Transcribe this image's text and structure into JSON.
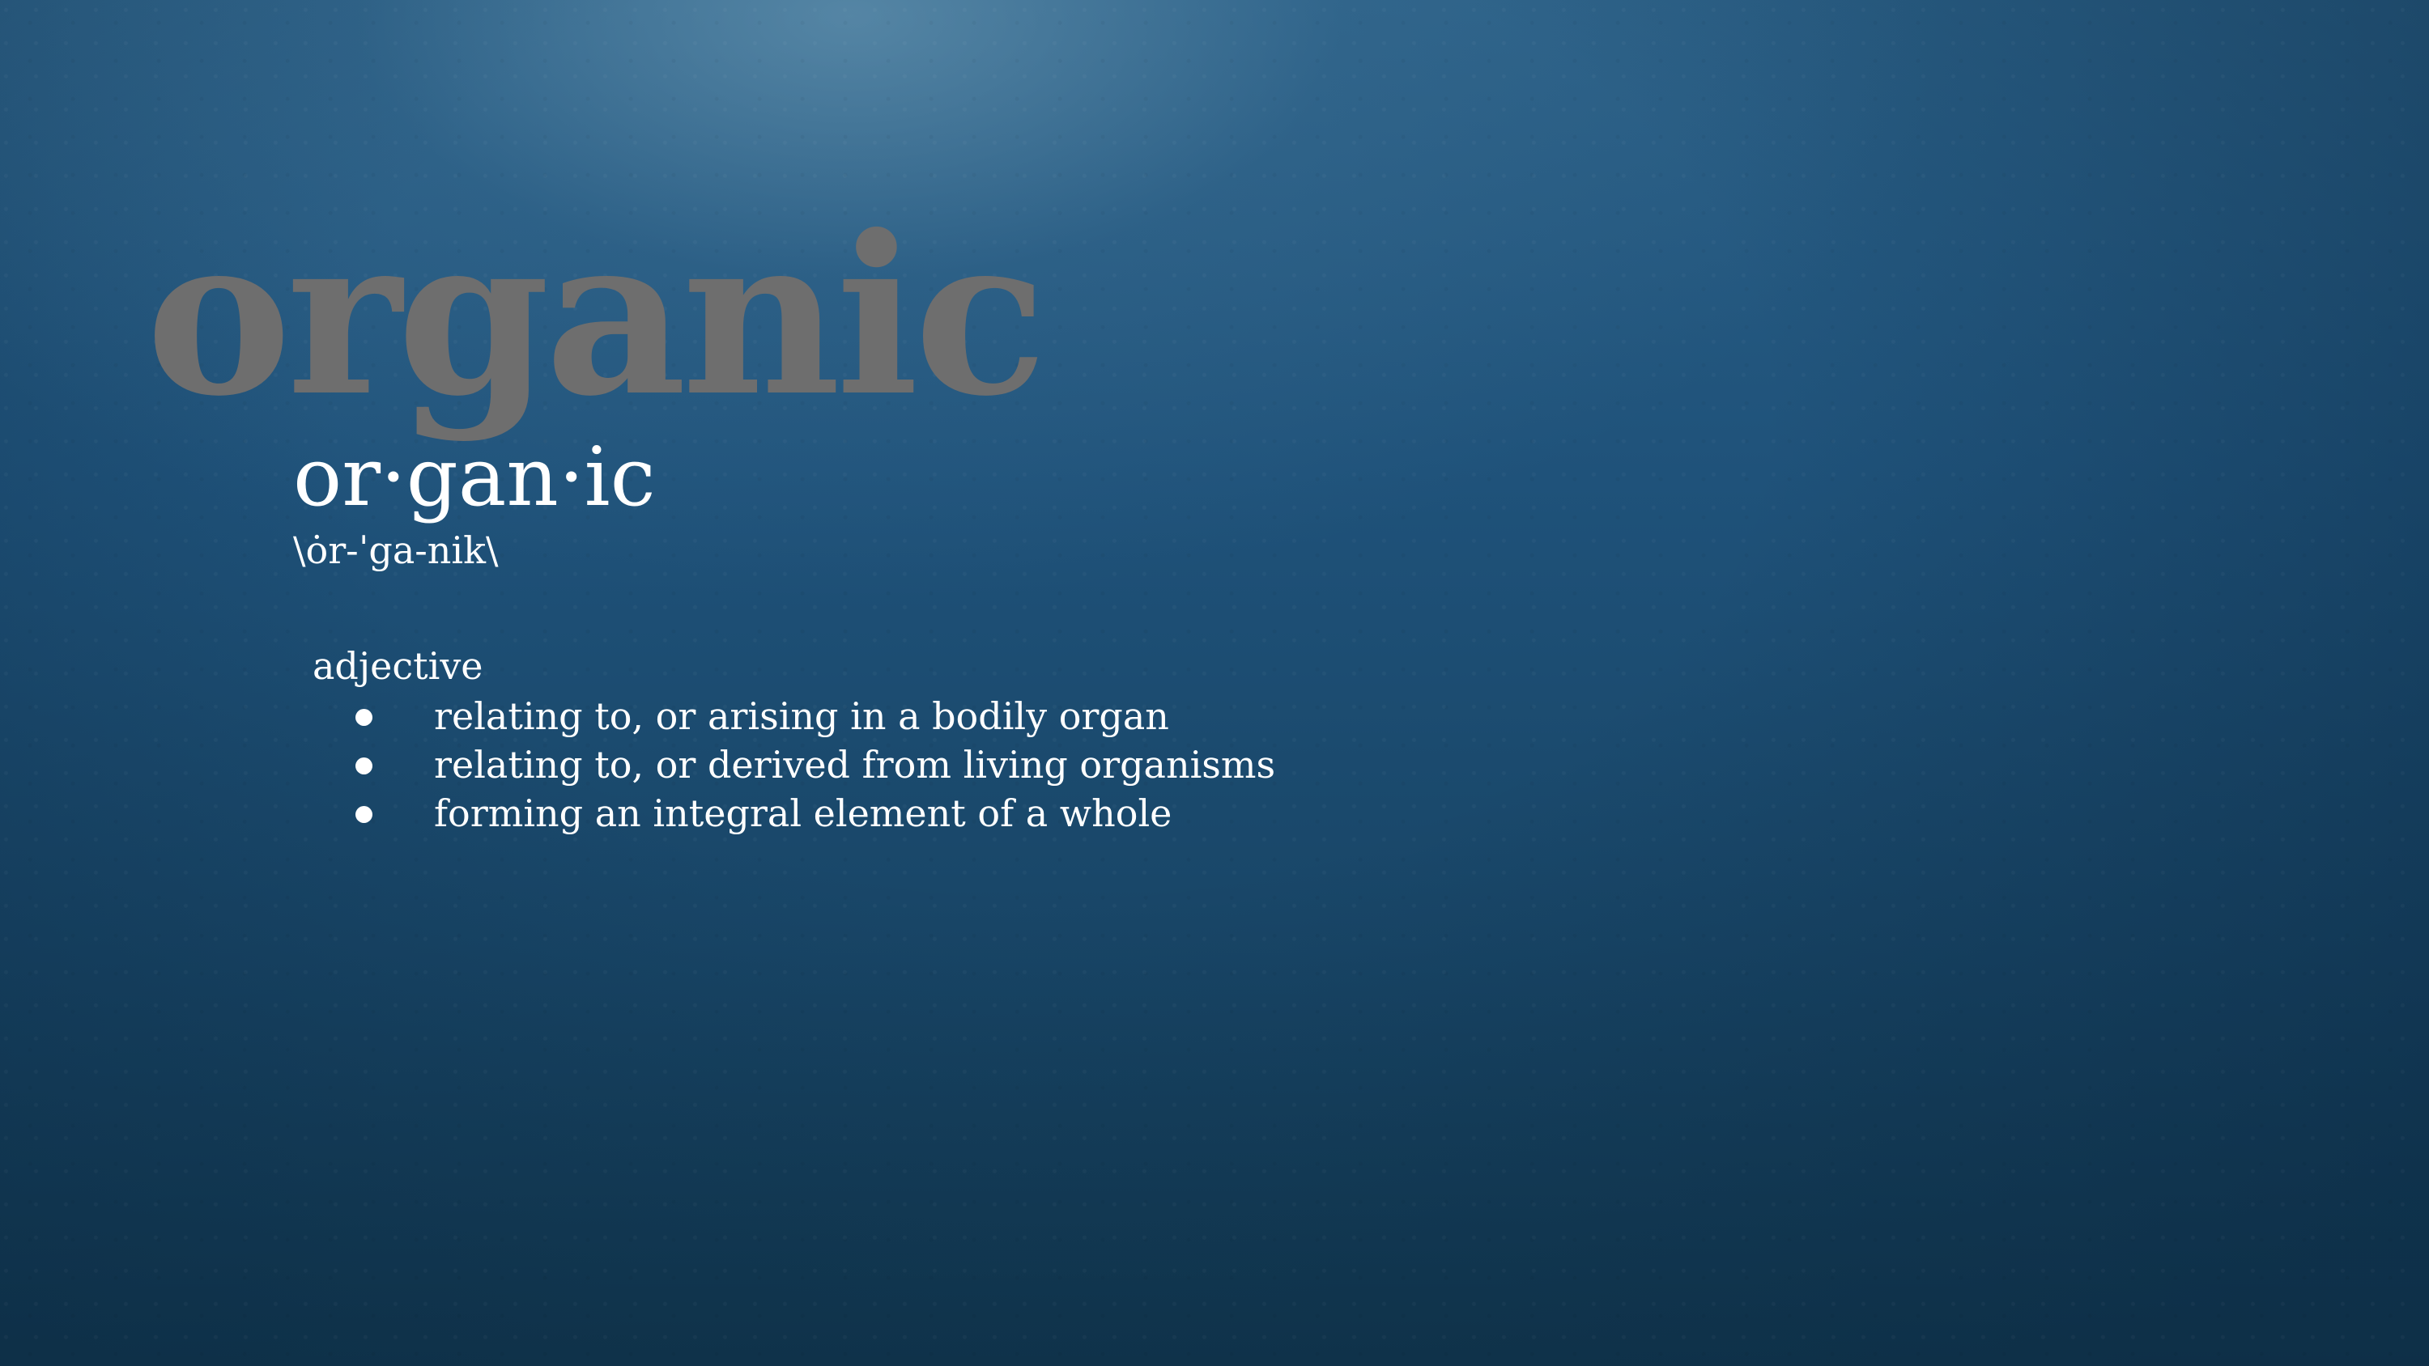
{
  "slide": {
    "headword_large": "organic",
    "headword_syllables": "or·gan·ic",
    "pronunciation": "\\ȯr-ˈga-nik\\",
    "part_of_speech": "adjective",
    "definitions": [
      "relating to, or arising in a bodily organ",
      "relating to, or derived from living organisms",
      "forming an integral element of a whole"
    ]
  },
  "colors": {
    "background": "#1d4e73",
    "headword_large": "#6e6e6e",
    "text": "#ffffff"
  }
}
